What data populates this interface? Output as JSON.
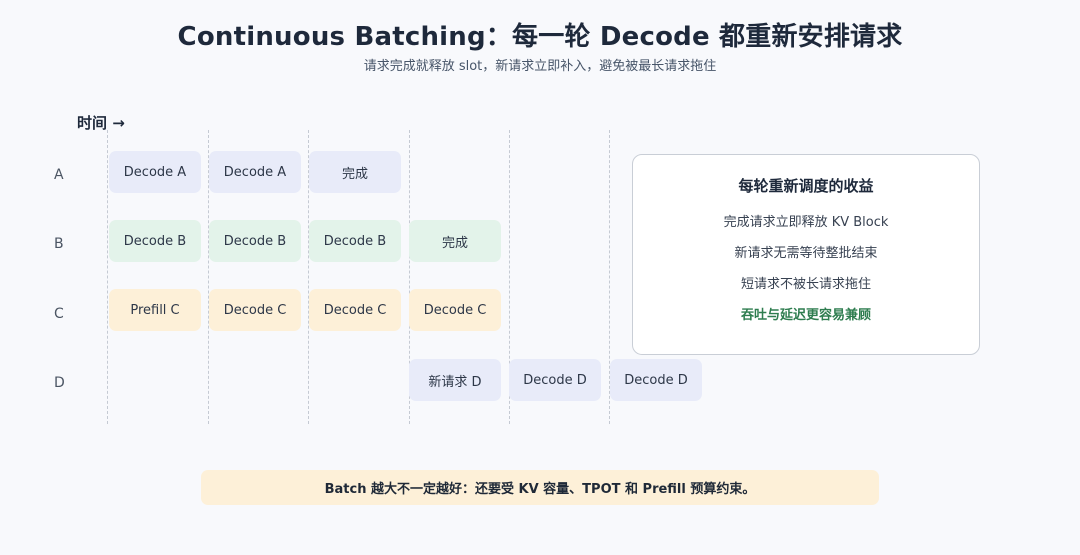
{
  "header": {
    "title": "Continuous Batching：每一轮 Decode 都重新安排请求",
    "subtitle": "请求完成就释放 slot，新请求立即补入，避免被最长请求拖住"
  },
  "timeline": {
    "time_label": "时间 →",
    "rows": [
      {
        "label": "A",
        "color": "#e8ebf9",
        "cells": [
          "Decode A",
          "Decode A",
          "完成"
        ]
      },
      {
        "label": "B",
        "color": "#e3f3ea",
        "cells": [
          "Decode B",
          "Decode B",
          "Decode B",
          "完成"
        ]
      },
      {
        "label": "C",
        "color": "#fdf0d8",
        "cells": [
          "Prefill C",
          "Decode C",
          "Decode C",
          "Decode C"
        ]
      },
      {
        "label": "D",
        "color": "#e8ebf9",
        "cells": [
          "新请求 D",
          "Decode D",
          "Decode D"
        ]
      }
    ]
  },
  "benefits": {
    "title": "每轮重新调度的收益",
    "items": [
      "完成请求立即释放 KV Block",
      "新请求无需等待整批结束",
      "短请求不被长请求拖住"
    ],
    "highlight": "吞吐与延迟更容易兼顾"
  },
  "footer_note": "Batch 越大不一定越好：还要受 KV 容量、TPOT 和 Prefill 预算约束。"
}
